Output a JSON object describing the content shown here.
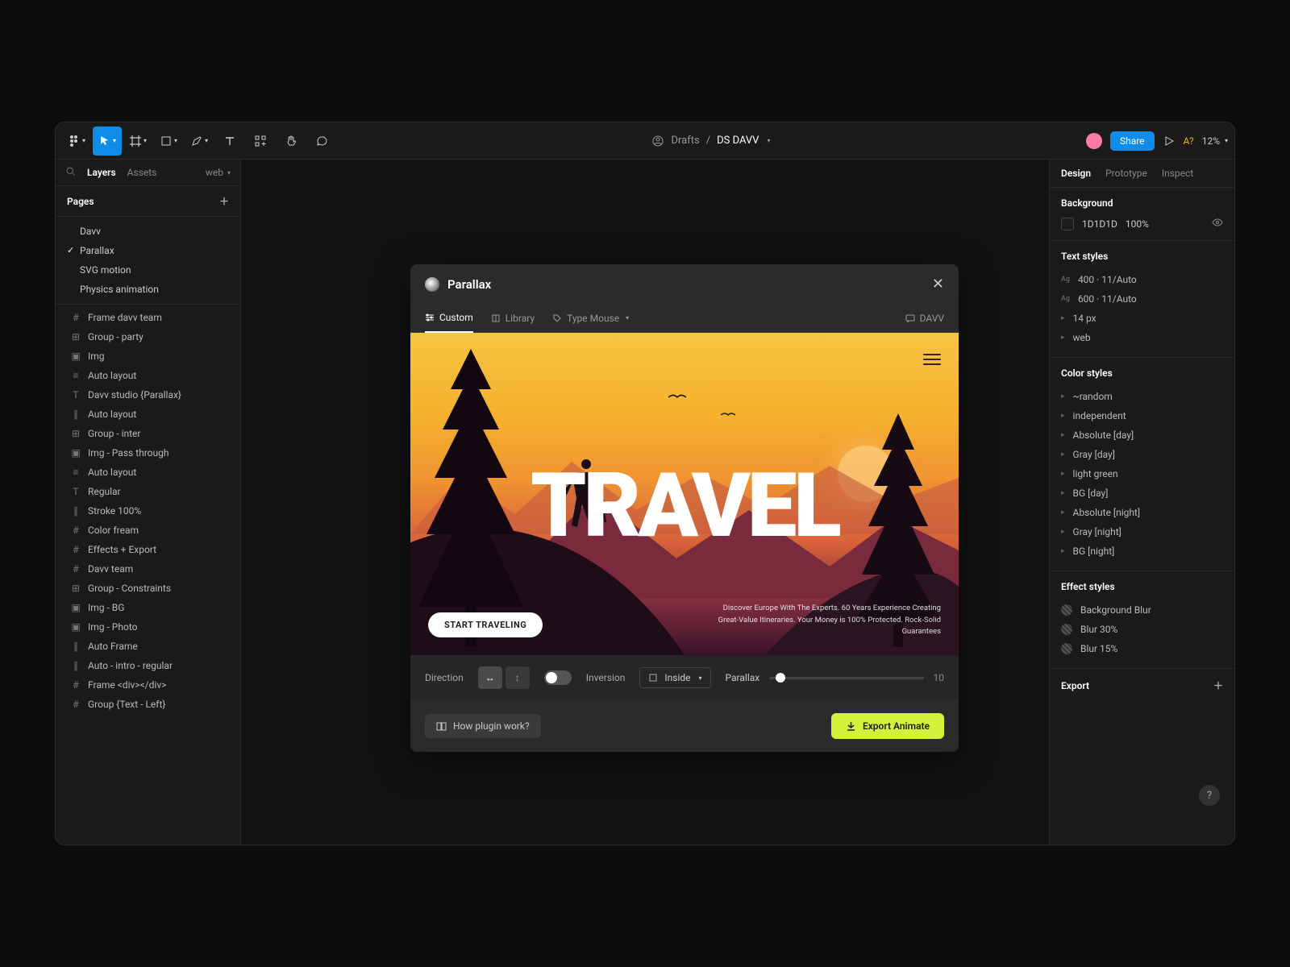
{
  "toolbar": {
    "breadcrumb_folder": "Drafts",
    "breadcrumb_sep": "/",
    "filename": "DS DAVV",
    "share_label": "Share",
    "a_q": "A?",
    "zoom": "12%"
  },
  "left_panel": {
    "tabs": {
      "layers": "Layers",
      "assets": "Assets",
      "web": "web"
    },
    "pages_header": "Pages",
    "pages": [
      {
        "label": "Davv",
        "selected": false
      },
      {
        "label": "Parallax",
        "selected": true
      },
      {
        "label": "SVG motion",
        "selected": false
      },
      {
        "label": "Physics animation",
        "selected": false
      }
    ],
    "layers": [
      {
        "icon": "#",
        "label": "Frame davv team"
      },
      {
        "icon": "⊞",
        "label": "Group - party"
      },
      {
        "icon": "▣",
        "label": "Img"
      },
      {
        "icon": "≡",
        "label": "Auto layout"
      },
      {
        "icon": "T",
        "label": "Davv studio {Parallax}"
      },
      {
        "icon": "∥",
        "label": "Auto layout"
      },
      {
        "icon": "⊞",
        "label": "Group - inter"
      },
      {
        "icon": "▣",
        "label": "Img - Pass through"
      },
      {
        "icon": "≡",
        "label": "Auto layout"
      },
      {
        "icon": "T",
        "label": "Regular"
      },
      {
        "icon": "∥",
        "label": "Stroke 100%"
      },
      {
        "icon": "#",
        "label": "Color fream"
      },
      {
        "icon": "#",
        "label": "Effects + Export"
      },
      {
        "icon": "#",
        "label": "Davv team"
      },
      {
        "icon": "⊞",
        "label": "Group - Constraints"
      },
      {
        "icon": "▣",
        "label": "Img - BG"
      },
      {
        "icon": "▣",
        "label": "Img - Photo"
      },
      {
        "icon": "∥",
        "label": "Auto Frame"
      },
      {
        "icon": "∥",
        "label": "Auto - intro - regular"
      },
      {
        "icon": "#",
        "label": "Frame <div></div>"
      },
      {
        "icon": "#",
        "label": "Group {Text - Left}"
      }
    ]
  },
  "plugin": {
    "title": "Parallax",
    "tabs": {
      "custom": "Custom",
      "library": "Library",
      "type": "Type Mouse",
      "davv": "DAVV"
    },
    "preview": {
      "headline": "TRAVEL",
      "cta": "START TRAVELING",
      "tagline": "Discover Europe With The Experts. 60 Years Experience Creating Great-Value Itineraries. Your Money is 100% Protected. Rock-Solid Guarantees"
    },
    "controls": {
      "direction_label": "Direction",
      "inversion_label": "Inversion",
      "inside_label": "Inside",
      "parallax_label": "Parallax",
      "parallax_value": "10"
    },
    "footer": {
      "help": "How plugin work?",
      "export": "Export Animate"
    }
  },
  "right_panel": {
    "tabs": {
      "design": "Design",
      "prototype": "Prototype",
      "inspect": "Inspect"
    },
    "bg": {
      "header": "Background",
      "hex": "1D1D1D",
      "opacity": "100%"
    },
    "text_styles": {
      "header": "Text styles",
      "items": [
        "400 · 11/Auto",
        "600 · 11/Auto",
        "14 px",
        "web"
      ]
    },
    "color_styles": {
      "header": "Color styles",
      "items": [
        "~random",
        "independent",
        "Absolute [day]",
        "Gray [day]",
        "light green",
        "BG [day]",
        "Absolute [night]",
        "Gray [night]",
        "BG [night]"
      ]
    },
    "effect_styles": {
      "header": "Effect styles",
      "items": [
        "Background Blur",
        "Blur 30%",
        "Blur 15%"
      ]
    },
    "export": "Export"
  }
}
